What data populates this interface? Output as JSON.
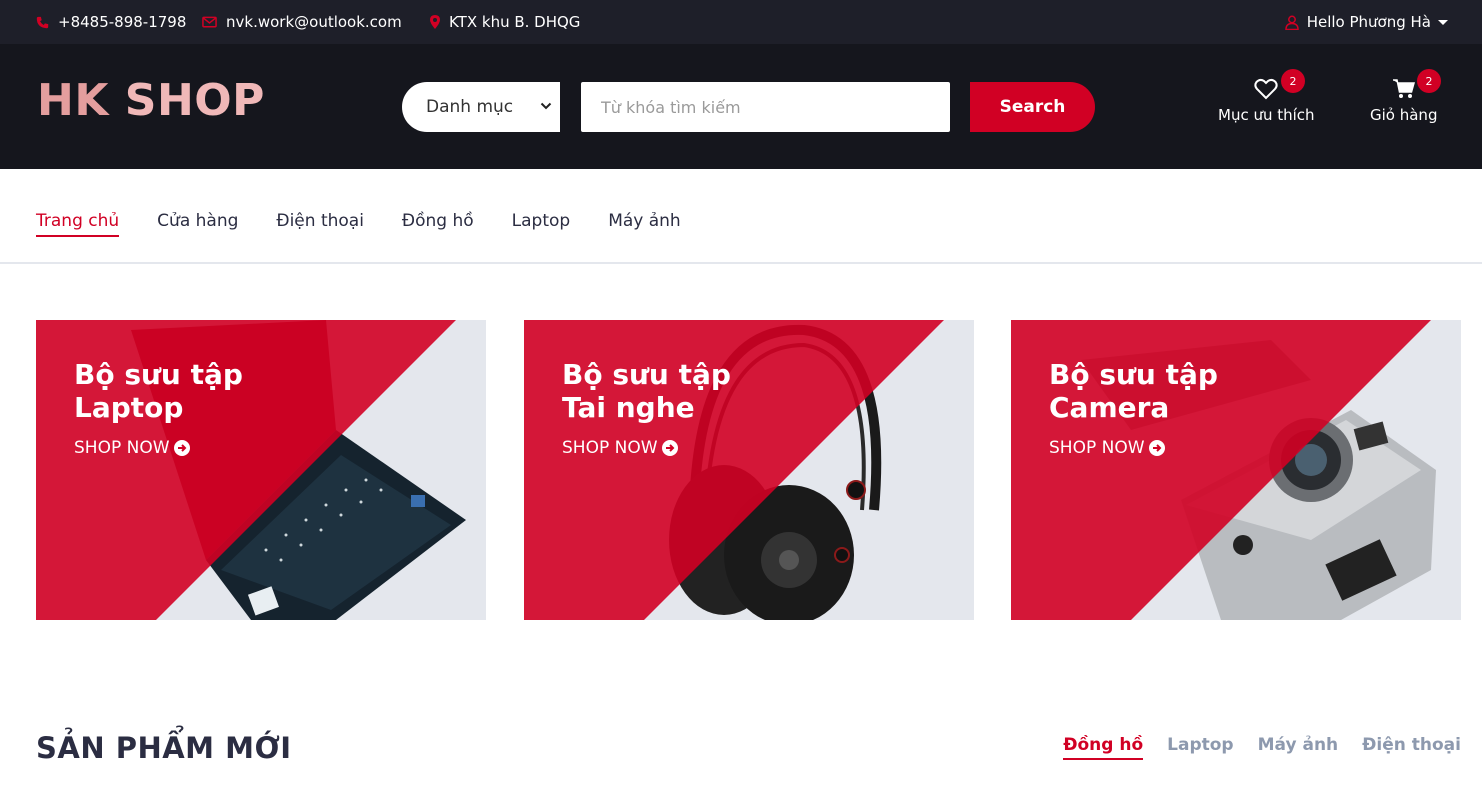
{
  "topbar": {
    "phone": "+8485-898-1798",
    "email": "nvk.work@outlook.com",
    "address": "KTX khu B. DHQG",
    "user_greeting": "Hello Phương Hà"
  },
  "header": {
    "logo_part1": "HK ",
    "logo_part2": "SHOP",
    "category_select": "Danh mục",
    "search_placeholder": "Từ khóa tìm kiếm",
    "search_button": "Search",
    "wishlist_label": "Mục ưu thích",
    "wishlist_count": "2",
    "cart_label": "Giỏ hàng",
    "cart_count": "2"
  },
  "nav": {
    "items": [
      {
        "label": "Trang chủ"
      },
      {
        "label": "Cửa hàng"
      },
      {
        "label": "Điện thoại"
      },
      {
        "label": "Đồng hồ"
      },
      {
        "label": "Laptop"
      },
      {
        "label": "Máy ảnh"
      }
    ]
  },
  "collections": [
    {
      "line1": "Bộ sưu tập",
      "line2": "Laptop",
      "cta": "SHOP NOW"
    },
    {
      "line1": "Bộ sưu tập",
      "line2": "Tai nghe",
      "cta": "SHOP NOW"
    },
    {
      "line1": "Bộ sưu tập",
      "line2": "Camera",
      "cta": "SHOP NOW"
    }
  ],
  "new_products": {
    "title": "SẢN PHẨM MỚI",
    "tabs": [
      "Đồng hồ",
      "Laptop",
      "Máy ảnh",
      "Điện thoại"
    ]
  },
  "colors": {
    "accent": "#D10024",
    "topbar_bg": "#1E1F29",
    "header_bg": "#15161D",
    "collection_bg": "#E4E7ED"
  }
}
